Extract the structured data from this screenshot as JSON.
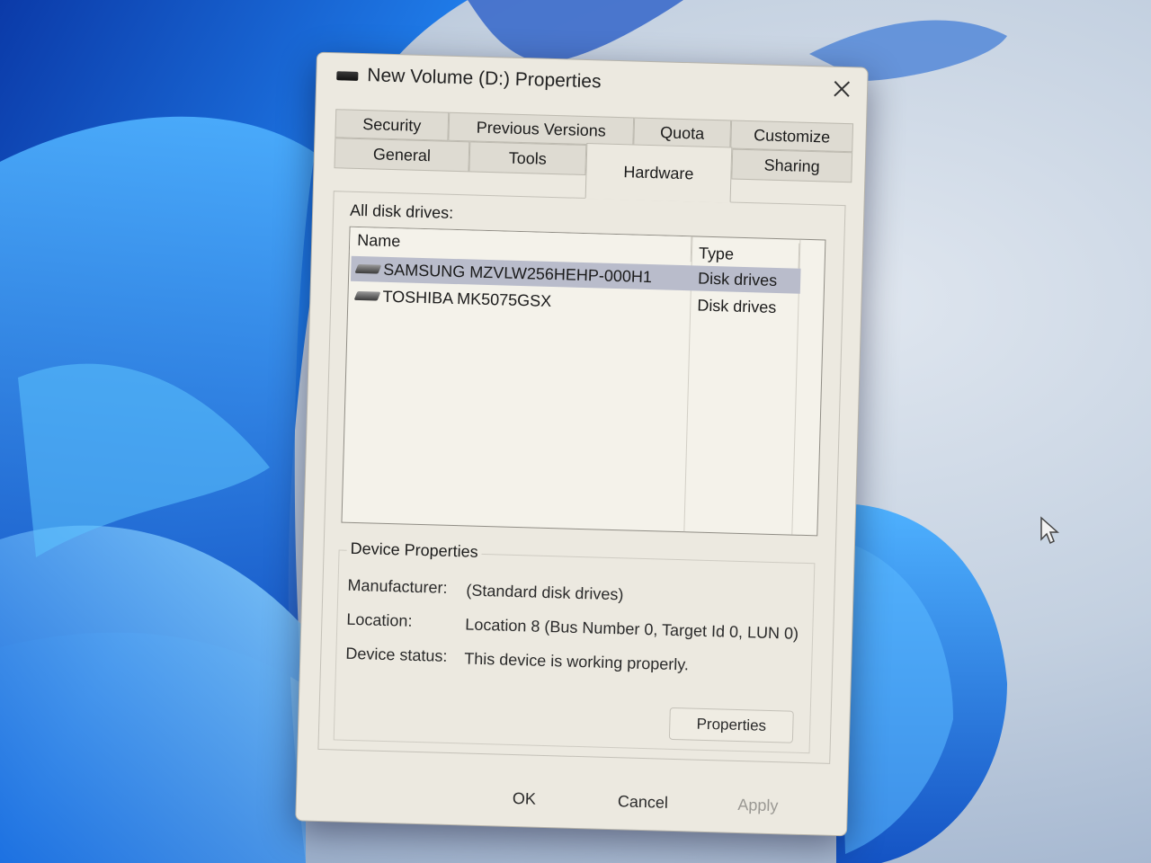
{
  "window": {
    "title": "New Volume (D:) Properties"
  },
  "tabs": [
    {
      "label": "Security"
    },
    {
      "label": "Previous Versions"
    },
    {
      "label": "Quota"
    },
    {
      "label": "Customize"
    },
    {
      "label": "General"
    },
    {
      "label": "Tools"
    },
    {
      "label": "Hardware",
      "active": true
    },
    {
      "label": "Sharing"
    }
  ],
  "hardware": {
    "list_label": "All disk drives:",
    "columns": {
      "name": "Name",
      "type": "Type"
    },
    "drives": [
      {
        "name": "SAMSUNG MZVLW256HEHP-000H1",
        "type": "Disk drives",
        "selected": true
      },
      {
        "name": "TOSHIBA MK5075GSX",
        "type": "Disk drives",
        "selected": false
      }
    ],
    "device_properties": {
      "title": "Device Properties",
      "manufacturer_label": "Manufacturer:",
      "manufacturer_value": "(Standard disk drives)",
      "location_label": "Location:",
      "location_value": "Location 8 (Bus Number 0, Target Id 0, LUN 0)",
      "status_label": "Device status:",
      "status_value": "This device is working properly.",
      "properties_button": "Properties"
    }
  },
  "footer": {
    "ok": "OK",
    "cancel": "Cancel",
    "apply": "Apply"
  },
  "icons": {
    "title": "drive-icon",
    "close": "close-icon",
    "drive_row": "hard-disk-icon",
    "cursor": "mouse-pointer-icon"
  },
  "colors": {
    "dialog_bg": "#ece9e0",
    "selection": "#b9bccb",
    "wallpaper_blue": "#1f6fe0"
  }
}
